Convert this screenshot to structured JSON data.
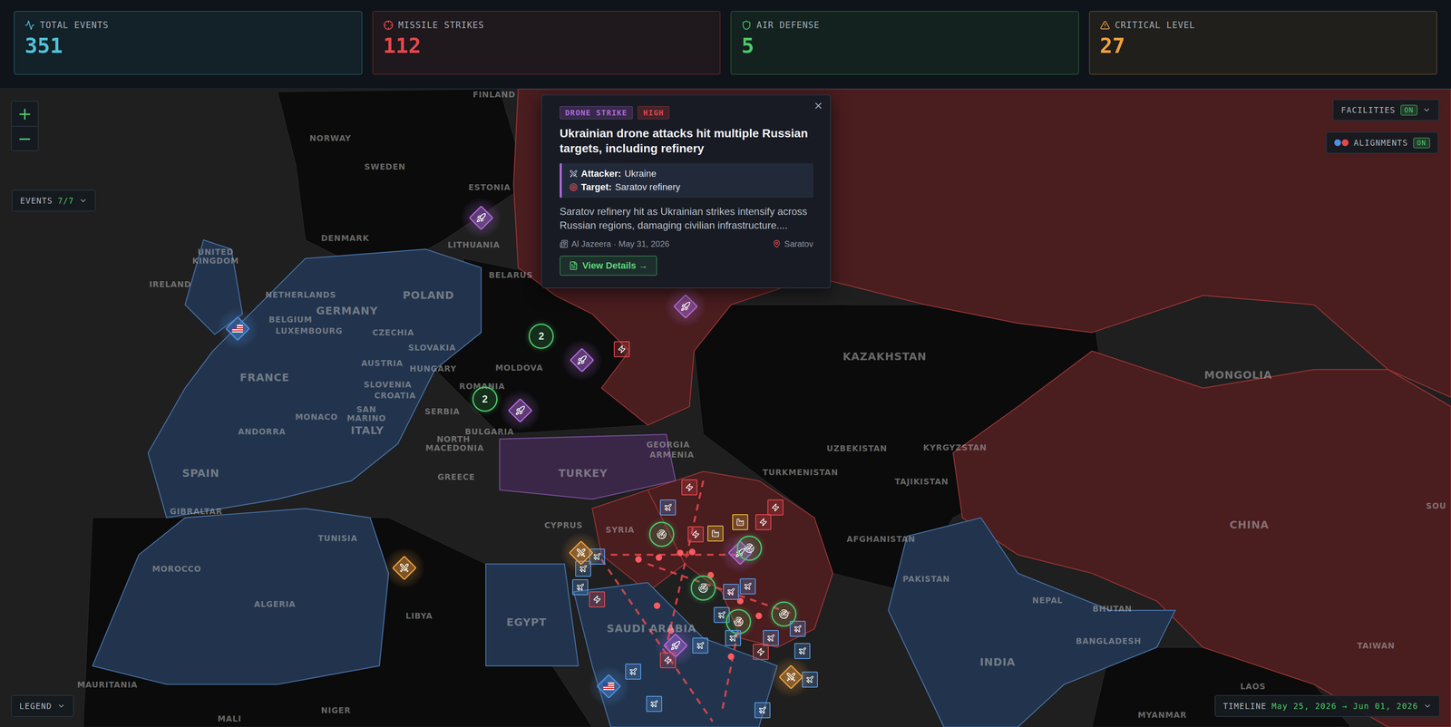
{
  "stats": [
    {
      "label": "TOTAL EVENTS",
      "value": "351",
      "color": "#4fc3d9",
      "kind": "activity"
    },
    {
      "label": "MISSILE STRIKES",
      "value": "112",
      "color": "#e5484d",
      "kind": "crosshair"
    },
    {
      "label": "AIR DEFENSE",
      "value": "5",
      "color": "#4cc96a",
      "kind": "shield"
    },
    {
      "label": "CRITICAL LEVEL",
      "value": "27",
      "color": "#f0a040",
      "kind": "alert"
    }
  ],
  "controls": {
    "zoom_in": "+",
    "zoom_out": "−",
    "events": {
      "label": "EVENTS",
      "count": "7/7"
    },
    "legend": "LEGEND",
    "facilities": {
      "label": "FACILITIES",
      "state": "ON",
      "on": true
    },
    "alignments": {
      "label": "ALIGNMENTS",
      "state": "ON",
      "on": true
    },
    "timeline": {
      "label": "TIMELINE",
      "range": "May 25, 2026 → Jun 01, 2026"
    }
  },
  "map": {
    "labels": [
      "FINLAND",
      "NORWAY",
      "SWEDEN",
      "ESTONIA",
      "DENMARK",
      "LITHUANIA",
      "UNITED KINGDOM",
      "IRELAND",
      "NETHERLANDS",
      "GERMANY",
      "POLAND",
      "BELARUS",
      "BELGIUM",
      "LUXEMBOURG",
      "CZECHIA",
      "SLOVAKIA",
      "FRANCE",
      "AUSTRIA",
      "HUNGARY",
      "MOLDOVA",
      "SLOVENIA",
      "CROATIA",
      "ROMANIA",
      "SAN MARINO",
      "MONACO",
      "SERBIA",
      "BULGARIA",
      "ANDORRA",
      "ITALY",
      "NORTH MACEDONIA",
      "GREECE",
      "SPAIN",
      "GIBRALTAR",
      "TUNISIA",
      "MOROCCO",
      "ALGERIA",
      "LIBYA",
      "EGYPT",
      "CYPRUS",
      "SYRIA",
      "TURKEY",
      "GEORGIA",
      "ARMENIA",
      "SAUDI ARABIA",
      "KAZAKHSTAN",
      "UZBEKISTAN",
      "TURKMENISTAN",
      "KYRGYZSTAN",
      "TAJIKISTAN",
      "AFGHANISTAN",
      "PAKISTAN",
      "MONGOLIA",
      "CHINA",
      "NEPAL",
      "BHUTAN",
      "BANGLADESH",
      "INDIA",
      "TAIWAN",
      "LAOS",
      "MYANMAR",
      "MAURITANIA",
      "NIGER",
      "MALI",
      "SOU"
    ],
    "markers": [
      {
        "kind": "drone"
      },
      {
        "kind": "drone"
      },
      {
        "kind": "drone"
      },
      {
        "kind": "drone"
      },
      {
        "kind": "missile"
      },
      {
        "kind": "cluster",
        "text": "2"
      },
      {
        "kind": "cluster",
        "text": "2"
      },
      {
        "kind": "flag"
      },
      {
        "kind": "strike"
      },
      {
        "kind": "flag"
      },
      {
        "kind": "missile"
      },
      {
        "kind": "air"
      },
      {
        "kind": "missile"
      },
      {
        "kind": "missile"
      },
      {
        "kind": "missile"
      },
      {
        "kind": "facility"
      },
      {
        "kind": "facility"
      },
      {
        "kind": "drone"
      },
      {
        "kind": "ring"
      },
      {
        "kind": "ring"
      },
      {
        "kind": "air"
      },
      {
        "kind": "air"
      },
      {
        "kind": "air"
      },
      {
        "kind": "missile"
      },
      {
        "kind": "strike"
      },
      {
        "kind": "ring"
      },
      {
        "kind": "air"
      },
      {
        "kind": "air"
      },
      {
        "kind": "air"
      },
      {
        "kind": "ring"
      },
      {
        "kind": "ring"
      },
      {
        "kind": "air"
      },
      {
        "kind": "air"
      },
      {
        "kind": "air"
      },
      {
        "kind": "strike"
      },
      {
        "kind": "air"
      },
      {
        "kind": "drone"
      },
      {
        "kind": "missile"
      },
      {
        "kind": "air"
      },
      {
        "kind": "air"
      },
      {
        "kind": "air"
      },
      {
        "kind": "air"
      },
      {
        "kind": "missile"
      },
      {
        "kind": "air"
      }
    ]
  },
  "popup": {
    "close": "×",
    "tags": [
      {
        "label": "DRONE STRIKE",
        "color": "#b06bdd"
      },
      {
        "label": "HIGH",
        "color": "#e5484d"
      }
    ],
    "title": "Ukrainian drone attacks hit multiple Russian targets, including refinery",
    "attacker_label": "Attacker:",
    "attacker": "Ukraine",
    "target_label": "Target:",
    "target": "Saratov refinery",
    "description": "Saratov refinery hit as Ukrainian strikes intensify across Russian regions, damaging civilian infrastructure....",
    "source": "Al Jazeera · May 31, 2026",
    "location": "Saratov",
    "button": "View Details →"
  }
}
